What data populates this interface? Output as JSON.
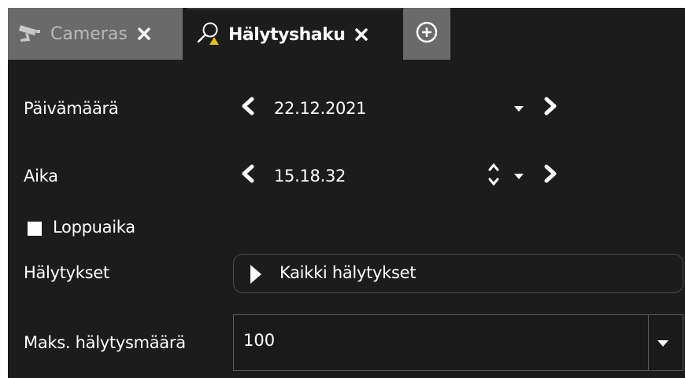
{
  "tabs": {
    "cameras_label": "Cameras",
    "alarm_label": "Hälytyshaku"
  },
  "form": {
    "date_label": "Päivämäärä",
    "date_value": "22.12.2021",
    "time_label": "Aika",
    "time_value": "15.18.32",
    "end_time_label": "Loppuaika",
    "end_time_checked": false,
    "alarms_label": "Hälytykset",
    "alarms_value": "Kaikki hälytykset",
    "max_label": "Maks. hälytysmäärä",
    "max_value": "100"
  },
  "icons": {
    "cameras_tab": "security-camera-icon",
    "alarm_tab": "search-alarm-icon",
    "close": "close-icon",
    "add_tab": "plus-circle-icon",
    "prev": "chevron-left-icon",
    "next": "chevron-right-icon",
    "dropdown": "caret-down-icon",
    "spinner": "spinner-updown-icon",
    "expand": "triangle-right-icon"
  },
  "colors": {
    "background": "#1c1c1c",
    "inactive_tab": "#6a6a6a",
    "text": "#ffffff",
    "warning_dot": "#e8c11a"
  }
}
